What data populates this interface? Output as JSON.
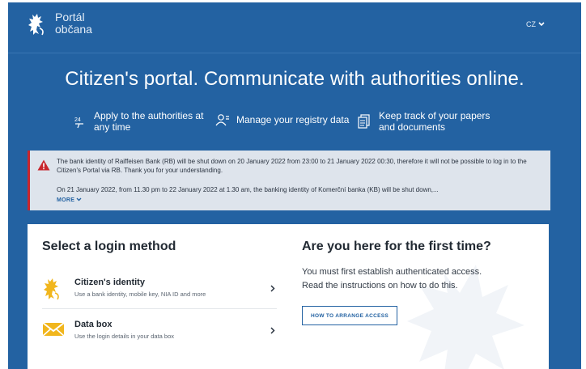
{
  "header": {
    "logo_line1": "Portál",
    "logo_line2": "občana",
    "language": "CZ"
  },
  "hero": {
    "title": "Citizen's portal. Communicate with authorities online.",
    "features": [
      {
        "icon": "clock-24-icon",
        "label_line1": "Apply to the authorities at",
        "label_line2": "any time"
      },
      {
        "icon": "person-registry-icon",
        "label_line1": "Manage your registry data",
        "label_line2": ""
      },
      {
        "icon": "documents-icon",
        "label_line1": "Keep track of your papers",
        "label_line2": "and documents"
      }
    ]
  },
  "alert": {
    "icon": "warning-triangle-icon",
    "paragraph1": "The bank identity of Raiffeisen Bank (RB) will be shut down on 20 January 2022 from 23:00 to 21 January 2022 00:30, therefore it will not be possible to log in to the Citizen's Portal via RB. Thank you for your understanding.",
    "paragraph2": "On 21 January 2022, from 11.30 pm to 22 January 2022 at 1.30 am, the banking identity of Komerční banka (KB) will be shut down,...",
    "more_label": "MORE"
  },
  "login": {
    "title": "Select a login method",
    "methods": [
      {
        "icon": "lion-emblem-icon",
        "title": "Citizen's identity",
        "subtitle": "Use a bank identity, mobile key, NIA ID and more"
      },
      {
        "icon": "data-box-icon",
        "title": "Data box",
        "subtitle": "Use the login details in your data box"
      }
    ]
  },
  "first_time": {
    "title": "Are you here for the first time?",
    "text_line1": "You must first establish authenticated access.",
    "text_line2": "Read the instructions on how to do this.",
    "button_label": "HOW TO ARRANGE ACCESS"
  },
  "colors": {
    "primary": "#2362a2",
    "alert_background": "#dee4ec",
    "alert_accent": "#c8262d",
    "emblem_gold": "#f1b61d"
  }
}
